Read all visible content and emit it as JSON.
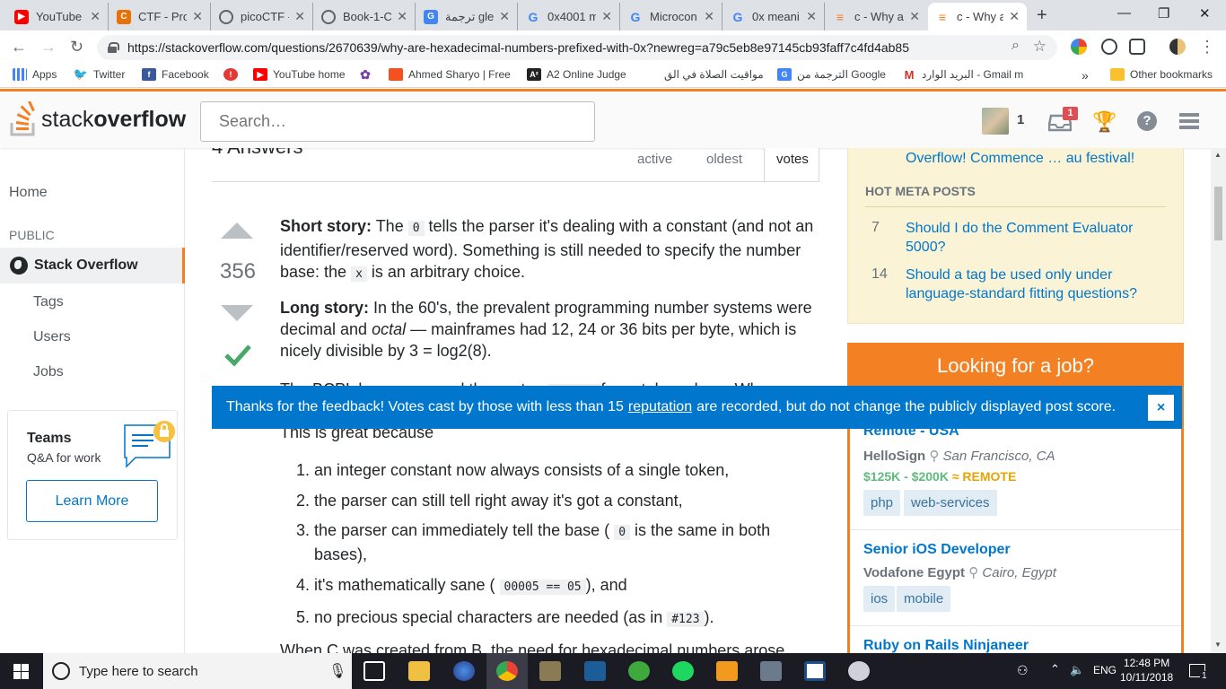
{
  "browser": {
    "tabs": [
      {
        "title": "YouTube",
        "icon": "youtube-icon",
        "color": "#ff0000"
      },
      {
        "title": "CTF - Pro",
        "icon": "ctf-icon",
        "color": "#e8710a"
      },
      {
        "title": "picoCTF -",
        "icon": "picoctf-icon",
        "color": "#5f6368"
      },
      {
        "title": "Book-1-C",
        "icon": "book-icon",
        "color": "#5f6368"
      },
      {
        "title": "ترجمة gle",
        "icon": "google-translate-icon",
        "color": "#4285f4"
      },
      {
        "title": "0x4001 m",
        "icon": "google-icon",
        "color": "#4285f4"
      },
      {
        "title": "Microcon",
        "icon": "google-icon",
        "color": "#4285f4"
      },
      {
        "title": "0x meani",
        "icon": "google-icon",
        "color": "#4285f4"
      },
      {
        "title": "c - Why a",
        "icon": "stackoverflow-icon",
        "color": "#f48024"
      },
      {
        "title": "c - Why a",
        "icon": "stackoverflow-icon",
        "color": "#f48024"
      }
    ],
    "url": "https://stackoverflow.com/questions/2670639/why-are-hexadecimal-numbers-prefixed-with-0x?newreg=a79c5eb8e97145cb93faff7c4fd4ab85",
    "bookmarks": [
      {
        "label": "Apps",
        "color": "#4285f4"
      },
      {
        "label": "Twitter",
        "color": "#1da1f2"
      },
      {
        "label": "Facebook",
        "color": "#3b5998"
      },
      {
        "label": "",
        "color": "#e53935"
      },
      {
        "label": "YouTube home",
        "color": "#ff0000"
      },
      {
        "label": "",
        "color": "#7b3fa0"
      },
      {
        "label": "Ahmed Sharyo | Free",
        "color": "#f4511e"
      },
      {
        "label": "A2 Online Judge",
        "color": "#222222"
      },
      {
        "label": "مواقيت الصلاة في الق",
        "color": "#ffffff"
      },
      {
        "label": "الترجمة من Google",
        "color": "#4285f4"
      },
      {
        "label": "البريد الوارد - Gmail m",
        "color": "#d93025"
      },
      {
        "label": "Other bookmarks",
        "color": "#fbc02d"
      }
    ]
  },
  "topbar": {
    "logo_prefix": "stack",
    "logo_suffix": "overflow",
    "search_placeholder": "Search…",
    "reputation": "1",
    "inbox_badge": "1"
  },
  "leftnav": {
    "home": "Home",
    "public": "PUBLIC",
    "stack_overflow": "Stack Overflow",
    "tags": "Tags",
    "users": "Users",
    "jobs": "Jobs",
    "teams_title": "Teams",
    "teams_sub": "Q&A for work",
    "learn_more": "Learn More"
  },
  "answers": {
    "heading": "4 Answers",
    "sort_tabs": [
      "active",
      "oldest",
      "votes"
    ],
    "score": "356",
    "short_label": "Short story:",
    "short_text_1": " The ",
    "short_code_1": "0",
    "short_text_2": " tells the parser it's dealing with a constant (and not an identifier/reserved word). Something is still needed to specify the number base: the ",
    "short_code_2": "x",
    "short_text_3": " is an arbitrary choice.",
    "long_label": "Long story:",
    "long_text_1": " In the 60's, the prevalent programming number systems were decimal and ",
    "long_em": "octal",
    "long_text_2": " — mainframes had 12, 24 or 36 bits per byte, which is nicely divisible by 3 = log2(8).",
    "hidden_line_start": "The BCPL language used the syntax",
    "hidden_line_end": "for octal numbers. Wh",
    "great": "This is great because",
    "list": [
      {
        "pre": "an integer constant now always consists of a single token,",
        "code": "",
        "post": ""
      },
      {
        "pre": "the parser can still tell right away it's got a constant,",
        "code": "",
        "post": ""
      },
      {
        "pre": "the parser can immediately tell the base (",
        "code": "0",
        "post": " is the same in both bases),"
      },
      {
        "pre": "it's mathematically sane (",
        "code": "00005 == 05",
        "post": "), and"
      },
      {
        "pre": "no precious special characters are needed (as in ",
        "code": "#123",
        "post": ")."
      }
    ],
    "last_line": "When C was created from B, the need for hexadecimal numbers arose"
  },
  "meta": {
    "featured_tail": "Overflow! Commence … au festival!",
    "hot_heading": "HOT META POSTS",
    "posts": [
      {
        "count": "7",
        "title": "Should I do the Comment Evaluator 5000?"
      },
      {
        "count": "14",
        "title": "Should a tag be used only under language-standard fitting questions?"
      }
    ]
  },
  "jobs": {
    "heading": "Looking for a job?",
    "items": [
      {
        "title": "Remote - USA",
        "company": "HelloSign",
        "location": "San Francisco, CA",
        "salary": "$125K - $200K",
        "remote": "REMOTE",
        "tags": [
          "php",
          "web-services"
        ]
      },
      {
        "title": "Senior iOS Developer",
        "company": "Vodafone Egypt",
        "location": "Cairo, Egypt",
        "salary": "",
        "remote": "",
        "tags": [
          "ios",
          "mobile"
        ]
      },
      {
        "title": "Ruby on Rails Ninjaneer",
        "company": "",
        "location": "",
        "salary": "",
        "remote": "",
        "tags": []
      }
    ]
  },
  "notification": {
    "text_before": "Thanks for the feedback! Votes cast by those with less than 15 ",
    "link": "reputation",
    "text_after": " are recorded, but do not change the publicly displayed post score.",
    "close": "×"
  },
  "taskbar": {
    "search_placeholder": "Type here to search",
    "lang": "ENG",
    "time": "12:48 PM",
    "date": "10/11/2018",
    "notif_count": "1"
  },
  "colors": {
    "brand": "#f48024",
    "link": "#0077cc",
    "accepted": "#48a868",
    "notify": "#0077cc"
  }
}
